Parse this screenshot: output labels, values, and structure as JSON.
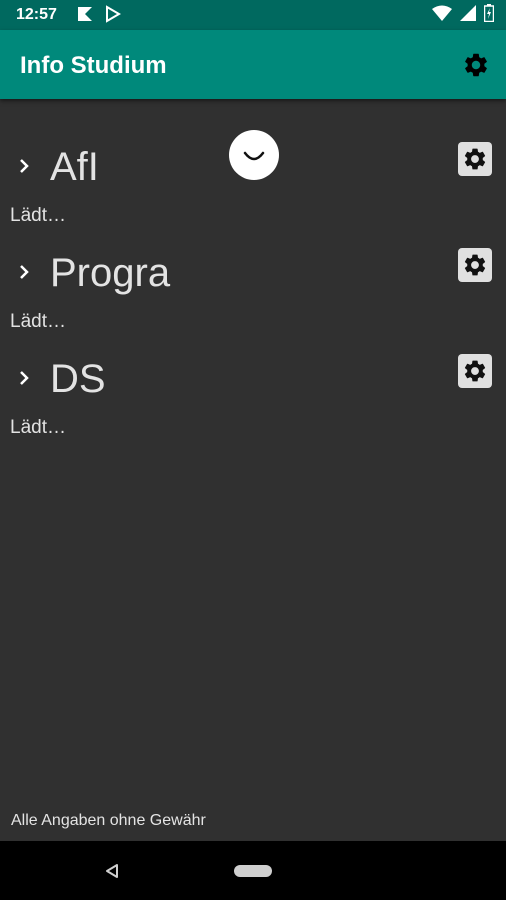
{
  "status_bar": {
    "time": "12:57",
    "left_icons": [
      "notification-icon",
      "play-store-icon"
    ],
    "right_icons": [
      "wifi-icon",
      "cell-signal-icon",
      "battery-icon"
    ]
  },
  "app_bar": {
    "title": "Info Studium",
    "background": "#00897b",
    "action_icon": "gear-icon"
  },
  "courses": [
    {
      "name": "AfI",
      "status": "Lädt…"
    },
    {
      "name": "Progra",
      "status": "Lädt…"
    },
    {
      "name": "DS",
      "status": "Lädt…"
    }
  ],
  "overlay_icon": "smiley-icon",
  "footer": {
    "note": "Alle Angaben ohne Gewähr"
  },
  "nav_bar": {
    "buttons": [
      "back-icon",
      "home-pill"
    ]
  }
}
